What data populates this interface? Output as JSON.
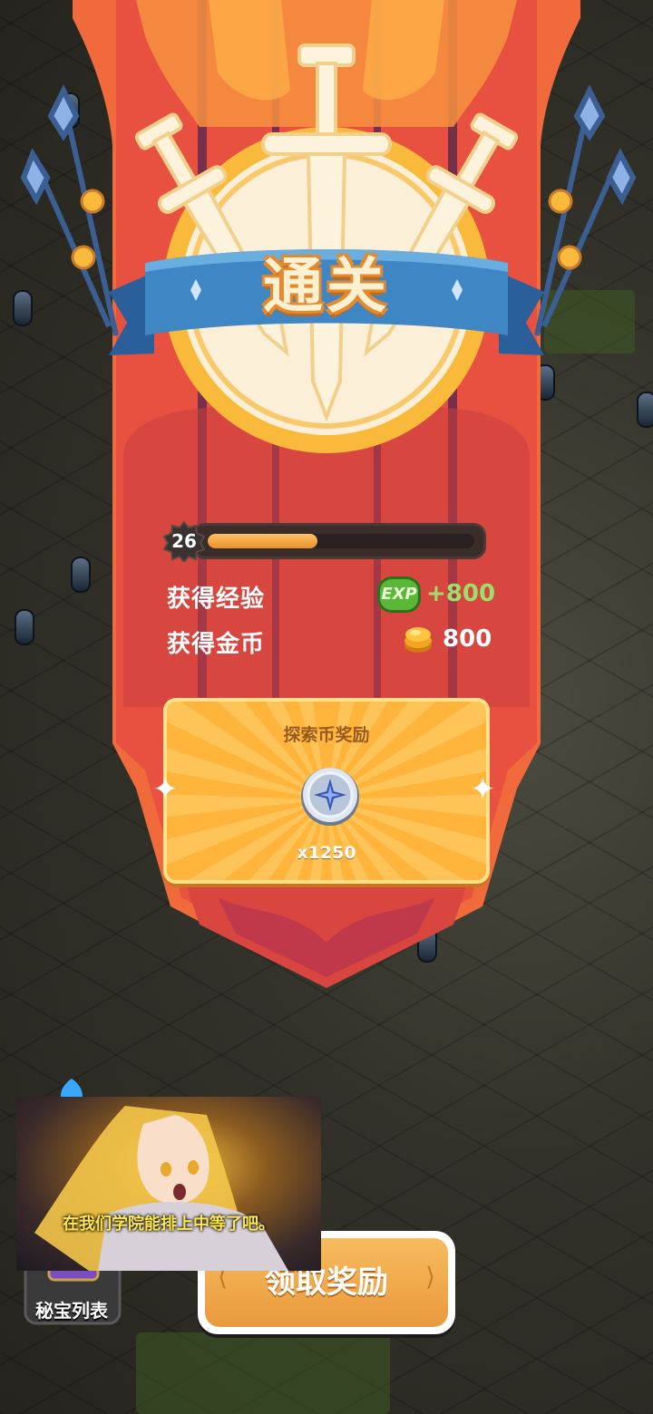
{
  "result": {
    "title": "通关",
    "level": "26",
    "exp_progress": 0.41,
    "exp_label": "获得经验",
    "exp_icon_text": "EXP",
    "exp_value": "+800",
    "gold_label": "获得金币",
    "gold_value": "800"
  },
  "reward_card": {
    "title": "探索币奖励",
    "count": "x1250"
  },
  "buttons": {
    "claim_label": "领取奖励",
    "treasure_label": "秘宝列表"
  },
  "video_overlay": {
    "subtitle": "在我们学院能排上中等了吧。"
  },
  "colors": {
    "banner_red": "#e8513f",
    "ribbon_blue": "#3f86c4",
    "medal_gold": "#f9b93a",
    "exp_green": "#9be06a",
    "claim_orange": "#f2ad52"
  }
}
